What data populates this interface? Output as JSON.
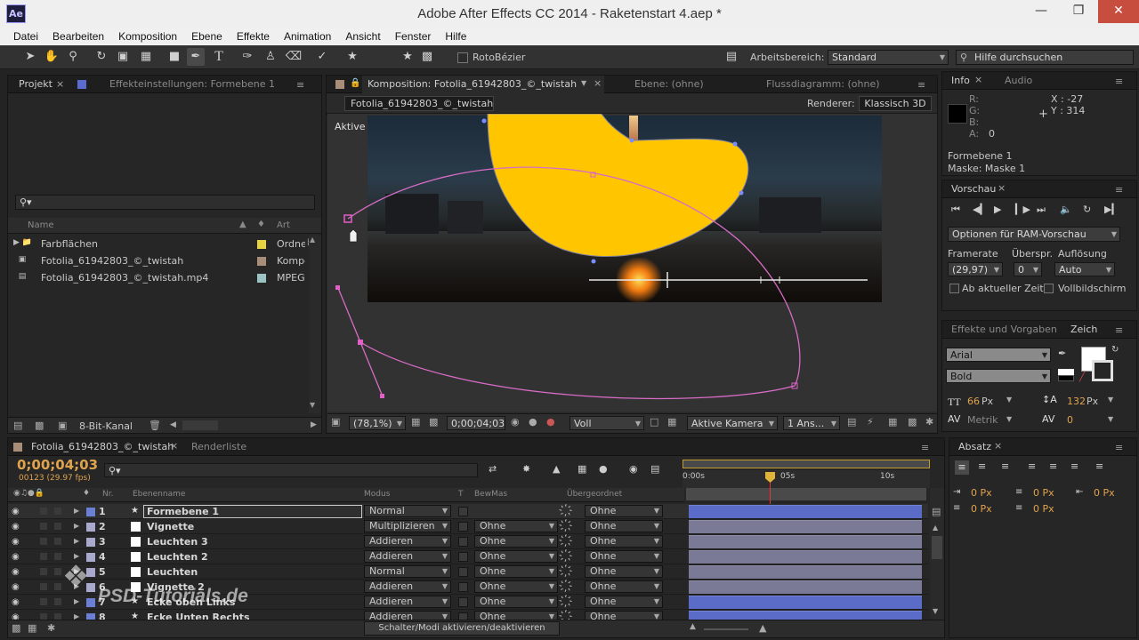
{
  "window": {
    "title": "Adobe After Effects CC 2014 - Raketenstart 4.aep *",
    "app_icon": "Ae"
  },
  "menu": [
    "Datei",
    "Bearbeiten",
    "Komposition",
    "Ebene",
    "Effekte",
    "Animation",
    "Ansicht",
    "Fenster",
    "Hilfe"
  ],
  "toolbar": {
    "roto_bezier": "RotoBézier",
    "workspace_label": "Arbeitsbereich:",
    "workspace_value": "Standard",
    "help_placeholder": "Hilfe durchsuchen"
  },
  "project_panel": {
    "tabs": [
      "Projekt",
      "Effekteinstellungen: Formebene 1"
    ],
    "columns": {
      "name": "Name",
      "type": "Art"
    },
    "items": [
      {
        "name": "Farbflächen",
        "type": "Ordne",
        "color": "#e6d342",
        "icon": "folder-icon"
      },
      {
        "name": "Fotolia_61942803_©_twistah",
        "type": "Kompo",
        "color": "#a88d78",
        "icon": "composition-icon"
      },
      {
        "name": "Fotolia_61942803_©_twistah.mp4",
        "type": "MPEG",
        "color": "#9cc3c3",
        "icon": "footage-icon"
      }
    ],
    "bit_depth": "8-Bit-Kanal"
  },
  "comp_panel": {
    "tabs": [
      "Komposition: Fotolia_61942803_©_twistah",
      "Ebene: (ohne)",
      "Flussdiagramm: (ohne)"
    ],
    "comp_button": "Fotolia_61942803_©_twistah",
    "renderer_label": "Renderer:",
    "renderer_value": "Klassisch 3D",
    "camera_label": "Aktive Kamera",
    "footer": {
      "zoom": "(78,1%)",
      "timecode": "0;00;04;03",
      "quality": "Voll",
      "camera": "Aktive Kamera",
      "views": "1 Ans..."
    }
  },
  "info_panel": {
    "tabs": [
      "Info",
      "Audio"
    ],
    "rgba": [
      "R:",
      "G:",
      "B:",
      "A:"
    ],
    "alpha_value": "0",
    "x": "X : -27",
    "y": "Y : 314",
    "layer": "Formebene 1",
    "mask": "Maske: Maske 1"
  },
  "preview_panel": {
    "tab": "Vorschau",
    "ram_options": "Optionen für RAM-Vorschau",
    "framerate_label": "Framerate",
    "skip_label": "Überspr.",
    "resolution_label": "Auflösung",
    "framerate_value": "(29,97)",
    "skip_value": "0",
    "resolution_value": "Auto",
    "from_current": "Ab aktueller Zeit",
    "fullscreen": "Vollbildschirm"
  },
  "effects_panel": {
    "tabs": [
      "Effekte und Vorgaben",
      "Zeich"
    ]
  },
  "char_panel": {
    "font": "Arial",
    "style": "Bold",
    "size": "66",
    "size_unit": "Px",
    "leading": "132",
    "leading_unit": "Px",
    "kerning": "Metrik",
    "tracking": "0"
  },
  "paragraph_panel": {
    "tab": "Absatz",
    "indents": [
      "0 Px",
      "0 Px",
      "0 Px",
      "0 Px",
      "0 Px"
    ]
  },
  "timeline": {
    "tabs": [
      "Fotolia_61942803_©_twistah",
      "Renderliste"
    ],
    "timecode": "0;00;04;03",
    "frames": "00123 (29.97 fps)",
    "columns": {
      "nr": "Nr.",
      "name": "Ebenenname",
      "mode": "Modus",
      "t": "T",
      "trkmat": "BewMas",
      "parent": "Übergeordnet"
    },
    "ruler": [
      "0:00s",
      "05s",
      "10s"
    ],
    "layers": [
      {
        "nr": "1",
        "name": "Formebene 1",
        "mode": "Normal",
        "trkmat": "",
        "parent": "Ohne",
        "color": "#6b7fd6",
        "star": true
      },
      {
        "nr": "2",
        "name": "Vignette",
        "mode": "Multiplizieren",
        "trkmat": "Ohne",
        "parent": "Ohne",
        "color": "#a9a9ce",
        "star": false
      },
      {
        "nr": "3",
        "name": "Leuchten 3",
        "mode": "Addieren",
        "trkmat": "Ohne",
        "parent": "Ohne",
        "color": "#a9a9ce",
        "star": false
      },
      {
        "nr": "4",
        "name": "Leuchten 2",
        "mode": "Addieren",
        "trkmat": "Ohne",
        "parent": "Ohne",
        "color": "#a9a9ce",
        "star": false
      },
      {
        "nr": "5",
        "name": "Leuchten",
        "mode": "Normal",
        "trkmat": "Ohne",
        "parent": "Ohne",
        "color": "#a9a9ce",
        "star": false
      },
      {
        "nr": "6",
        "name": "Vignette 2",
        "mode": "Addieren",
        "trkmat": "Ohne",
        "parent": "Ohne",
        "color": "#a9a9ce",
        "star": false
      },
      {
        "nr": "7",
        "name": "Ecke oben Links",
        "mode": "Addieren",
        "trkmat": "Ohne",
        "parent": "Ohne",
        "color": "#6b7fd6",
        "star": true
      },
      {
        "nr": "8",
        "name": "Ecke Unten Rechts",
        "mode": "Addieren",
        "trkmat": "Ohne",
        "parent": "Ohne",
        "color": "#6b7fd6",
        "star": true
      }
    ],
    "toggle_label": "Schalter/Modi aktivieren/deaktivieren"
  },
  "watermark": "PSD-Tutorials.de"
}
